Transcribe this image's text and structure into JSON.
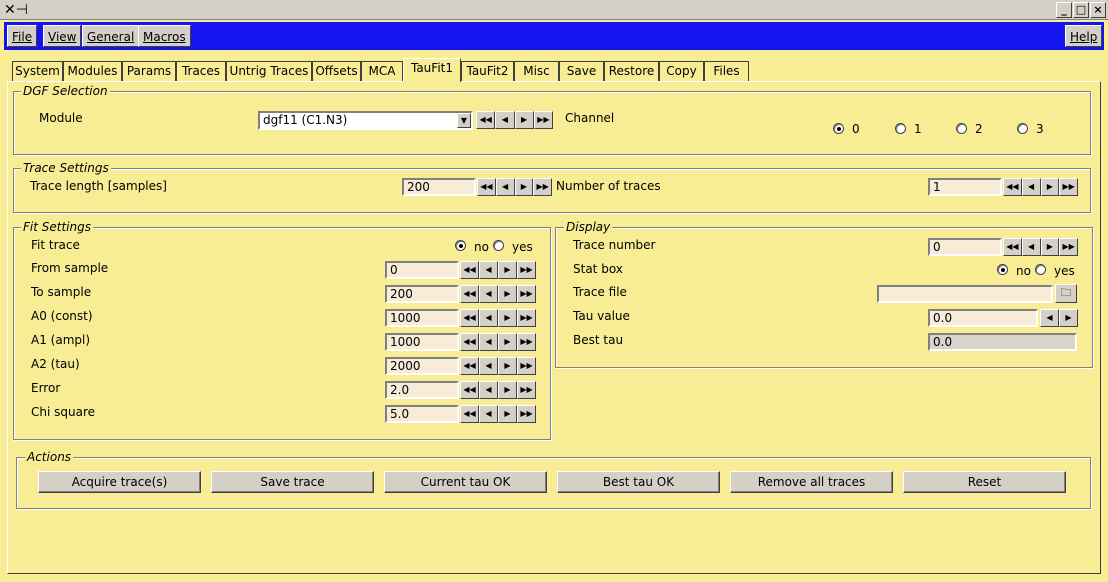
{
  "window": {
    "app_icon_glyph": "✕⊣"
  },
  "menu": {
    "file": "File",
    "view": "View",
    "general": "General",
    "macros": "Macros",
    "help": "Help"
  },
  "tabs": [
    "System",
    "Modules",
    "Params",
    "Traces",
    "Untrig Traces",
    "Offsets",
    "MCA",
    "TauFit1",
    "TauFit2",
    "Misc",
    "Save",
    "Restore",
    "Copy",
    "Files"
  ],
  "active_tab": "TauFit1",
  "dgf": {
    "title": "DGF Selection",
    "module_label": "Module",
    "module_value": "dgf11  (C1.N3)",
    "channel_label": "Channel",
    "channels": [
      "0",
      "1",
      "2",
      "3"
    ],
    "channel_selected": "0"
  },
  "trace_settings": {
    "title": "Trace Settings",
    "length_label": "Trace length [samples]",
    "length_value": "200",
    "num_label": "Number of traces",
    "num_value": "1"
  },
  "fit": {
    "title": "Fit Settings",
    "fit_trace_label": "Fit trace",
    "no": "no",
    "yes": "yes",
    "from_label": "From sample",
    "from_value": "0",
    "to_label": "To sample",
    "to_value": "200",
    "a0_label": "A0 (const)",
    "a0_value": "1000",
    "a1_label": "A1 (ampl)",
    "a1_value": "1000",
    "a2_label": "A2 (tau)",
    "a2_value": "2000",
    "error_label": "Error",
    "error_value": "2.0",
    "chi_label": "Chi square",
    "chi_value": "5.0"
  },
  "display": {
    "title": "Display",
    "trace_number_label": "Trace number",
    "trace_number_value": "0",
    "stat_box_label": "Stat box",
    "no": "no",
    "yes": "yes",
    "trace_file_label": "Trace file",
    "trace_file_value": "",
    "tau_label": "Tau value",
    "tau_value": "0.0",
    "best_tau_label": "Best tau",
    "best_tau_value": "0.0"
  },
  "actions": {
    "title": "Actions",
    "acquire": "Acquire trace(s)",
    "save": "Save trace",
    "current_ok": "Current tau OK",
    "best_ok": "Best tau OK",
    "remove": "Remove all traces",
    "reset": "Reset"
  },
  "colors": {
    "background": "#f8ec94",
    "menubar": "#1414f0",
    "entry": "#f8ecd8",
    "button": "#d4d0c8"
  }
}
